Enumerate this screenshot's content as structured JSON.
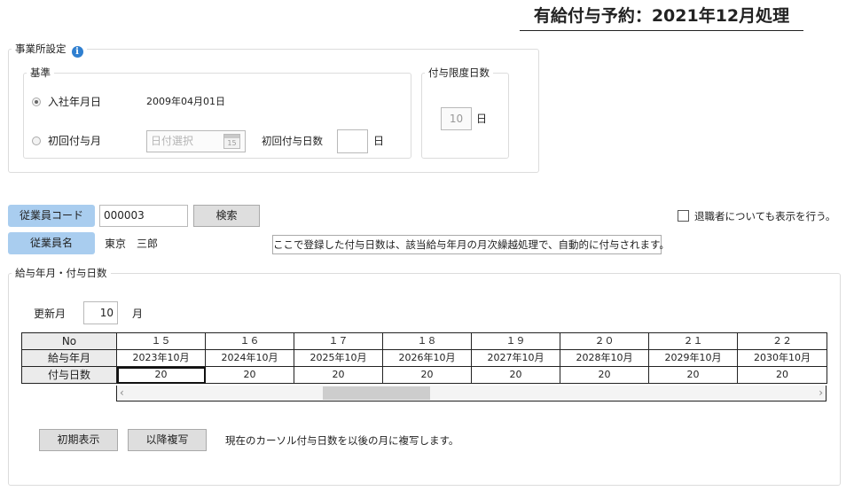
{
  "page_title": "有給付与予約：2021年12月処理",
  "office": {
    "legend": "事業所設定",
    "info_icon": "i",
    "basis": {
      "legend": "基準",
      "option1_label": "入社年月日",
      "option1_value": "2009年04月01日",
      "option2_label": "初回付与月",
      "date_placeholder": "日付選択",
      "calendar_day": "15",
      "first_grant_label": "初回付与日数",
      "first_grant_unit": "日"
    },
    "limit": {
      "legend": "付与限度日数",
      "value": "10",
      "unit": "日"
    }
  },
  "employee": {
    "code_label": "従業員コード",
    "code_value": "000003",
    "search_label": "検索",
    "name_label": "従業員名",
    "name_value": "東京　三郎",
    "retired_label": "退職者についても表示を行う。",
    "note": "ここで登録した付与日数は、該当給与年月の月次繰越処理で、自動的に付与されます。"
  },
  "grant": {
    "legend": "給与年月・付与日数",
    "update_month_label": "更新月",
    "update_month_value": "10",
    "update_month_unit": "月",
    "row_headers": [
      "No",
      "給与年月",
      "付与日数"
    ],
    "columns": [
      {
        "no": "１５",
        "month": "2023年10月",
        "days": "20"
      },
      {
        "no": "１６",
        "month": "2024年10月",
        "days": "20"
      },
      {
        "no": "１７",
        "month": "2025年10月",
        "days": "20"
      },
      {
        "no": "１８",
        "month": "2026年10月",
        "days": "20"
      },
      {
        "no": "１９",
        "month": "2027年10月",
        "days": "20"
      },
      {
        "no": "２０",
        "month": "2028年10月",
        "days": "20"
      },
      {
        "no": "２１",
        "month": "2029年10月",
        "days": "20"
      },
      {
        "no": "２２",
        "month": "2030年10月",
        "days": "20"
      }
    ],
    "scroll_left": "‹",
    "scroll_right": "›",
    "reset_label": "初期表示",
    "copy_label": "以降複写",
    "copy_note": "現在のカーソル付与日数を以後の月に複写します。"
  }
}
